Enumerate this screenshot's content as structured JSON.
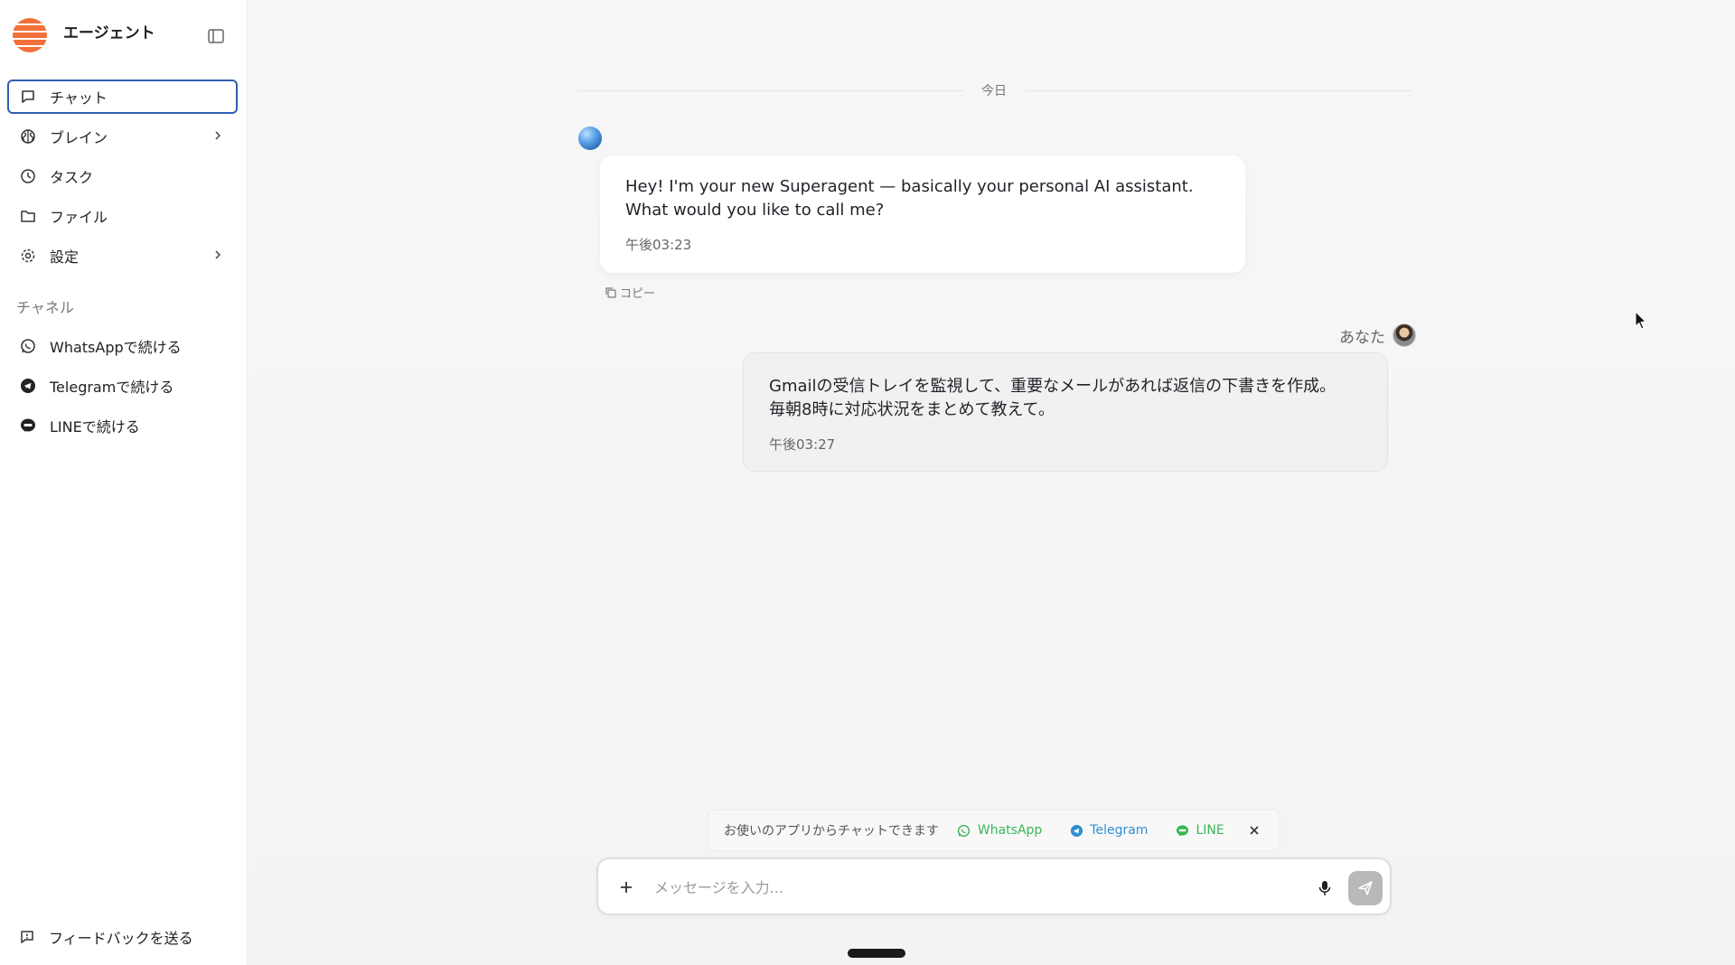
{
  "app": {
    "name": "エージェント"
  },
  "sidebar": {
    "nav": [
      {
        "label": "チャット",
        "icon": "chat-bubble-icon",
        "active": true
      },
      {
        "label": "ブレイン",
        "icon": "brain-icon",
        "expandable": true
      },
      {
        "label": "タスク",
        "icon": "clock-icon"
      },
      {
        "label": "ファイル",
        "icon": "folder-icon"
      },
      {
        "label": "設定",
        "icon": "gear-icon",
        "expandable": true
      }
    ],
    "channels_label": "チャネル",
    "channels": [
      {
        "label": "WhatsAppで続ける",
        "icon": "whatsapp-icon"
      },
      {
        "label": "Telegramで続ける",
        "icon": "telegram-icon"
      },
      {
        "label": "LINEで続ける",
        "icon": "line-icon"
      }
    ],
    "feedback_label": "フィードバックを送る"
  },
  "conversation": {
    "date_label": "今日",
    "agent_message": {
      "text": "Hey! I'm your new Superagent — basically your personal AI assistant. What would you like to call me?",
      "time": "午後03:23",
      "copy_label": "コピー"
    },
    "user_label": "あなた",
    "user_message": {
      "text_line1": "Gmailの受信トレイを監視して、重要なメールがあれば返信の下書きを作成。",
      "text_line2": "毎朝8時に対応状況をまとめて教えて。",
      "time": "午後03:27"
    }
  },
  "composer": {
    "banner_hint": "お使いのアプリからチャットできます",
    "apps": [
      {
        "label": "WhatsApp",
        "icon": "whatsapp-icon"
      },
      {
        "label": "Telegram",
        "icon": "telegram-icon"
      },
      {
        "label": "LINE",
        "icon": "line-icon"
      }
    ],
    "placeholder": "メッセージを入力..."
  },
  "colors": {
    "accent_border": "#2f5fb3",
    "brand_orange": "#f2703a",
    "whatsapp_green": "#3bb55a",
    "telegram_blue": "#2f8fd1"
  }
}
